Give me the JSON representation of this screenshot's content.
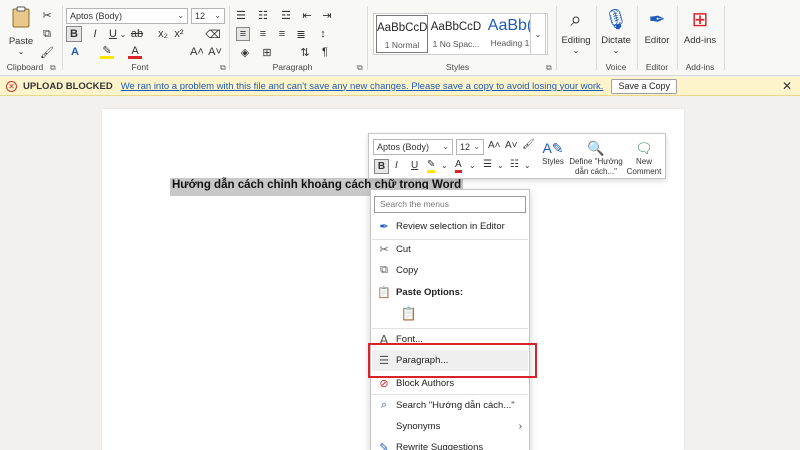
{
  "ribbon": {
    "clipboard": {
      "paste_label": "Paste",
      "group_label": "Clipboard"
    },
    "font": {
      "font_name": "Aptos (Body)",
      "font_size": "12",
      "group_label": "Font"
    },
    "paragraph": {
      "group_label": "Paragraph"
    },
    "styles": {
      "group_label": "Styles",
      "items": [
        {
          "sample": "AaBbCcD",
          "name": "1 Normal"
        },
        {
          "sample": "AaBbCcD",
          "name": "1 No Spac..."
        },
        {
          "sample": "AaBb(",
          "name": "Heading 1"
        }
      ]
    },
    "editing": {
      "label": "Editing"
    },
    "voice": {
      "dictate_label": "Dictate",
      "group_label": "Voice"
    },
    "editor": {
      "label": "Editor",
      "group_label": "Editor"
    },
    "addins": {
      "label": "Add-ins",
      "group_label": "Add-ins"
    }
  },
  "banner": {
    "title": "UPLOAD BLOCKED",
    "message": "We ran into a problem with this file and can't save any new changes. Please save a copy to avoid losing your work.",
    "save_copy_label": "Save a Copy"
  },
  "document": {
    "title_text": "Hướng dẫn cách chỉnh khoảng cách chữ trong Word"
  },
  "minibar": {
    "font_name": "Aptos (Body)",
    "font_size": "12",
    "styles_label": "Styles",
    "define_label_1": "Define \"Hướng",
    "define_label_2": "dẫn cách...\"",
    "new_comment_1": "New",
    "new_comment_2": "Comment"
  },
  "context_menu": {
    "search_placeholder": "Search the menus",
    "review_selection": "Review selection in Editor",
    "cut": "Cut",
    "copy": "Copy",
    "paste_options": "Paste Options:",
    "font": "Font...",
    "paragraph": "Paragraph...",
    "block_authors": "Block Authors",
    "search_item": "Search \"Hướng dẫn cách...\"",
    "synonyms": "Synonyms",
    "rewrite": "Rewrite Suggestions"
  },
  "colors": {
    "highlight_red": "#d8232a",
    "banner_bg": "#fdf4cc",
    "link_blue": "#1e5bb8",
    "accent_blue": "#1e5bb8"
  }
}
